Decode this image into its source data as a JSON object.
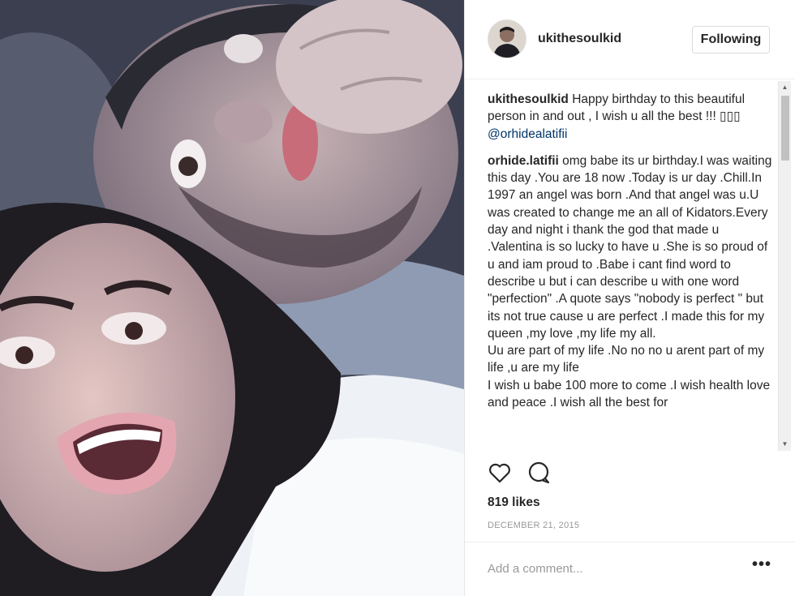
{
  "post": {
    "username": "ukithesoulkid",
    "follow_label": "Following",
    "likes": "819 likes",
    "date": "DECEMBER 21, 2015"
  },
  "comments": [
    {
      "author": "ukithesoulkid",
      "text": " Happy birthday to this beautiful person in and out , I wish u all the best !!! ▯▯▯ ",
      "mention": "@orhidealatifii"
    },
    {
      "author": "orhide.latifii",
      "text": " omg babe its ur birthday.I was waiting this day .You are 18 now .Today is ur day .Chill.In 1997 an angel was born .And that angel was u.U was created to change me an all of Kidators.Every day and night i thank the god that made u .Valentina is so lucky to have u .She is so proud of u and iam proud to .Babe i cant find word to describe u but i can describe u with one word \"perfection\" .A quote says \"nobody is perfect \" but its not true cause u are perfect .I made this for my queen ,my love ,my life my all.",
      "text2": "Uu are part of my life .No no no u arent part of my life ,u are my life",
      "text3": "I wish u babe 100 more to come .I wish health love and peace .I wish all the best for"
    }
  ],
  "add_comment": {
    "placeholder": "Add a comment..."
  },
  "icons": {
    "like": "heart-icon",
    "comment": "speech-bubble-icon",
    "more": "more-options-icon"
  },
  "colors": {
    "mention": "#003569",
    "text": "#262626",
    "muted": "#999999"
  }
}
